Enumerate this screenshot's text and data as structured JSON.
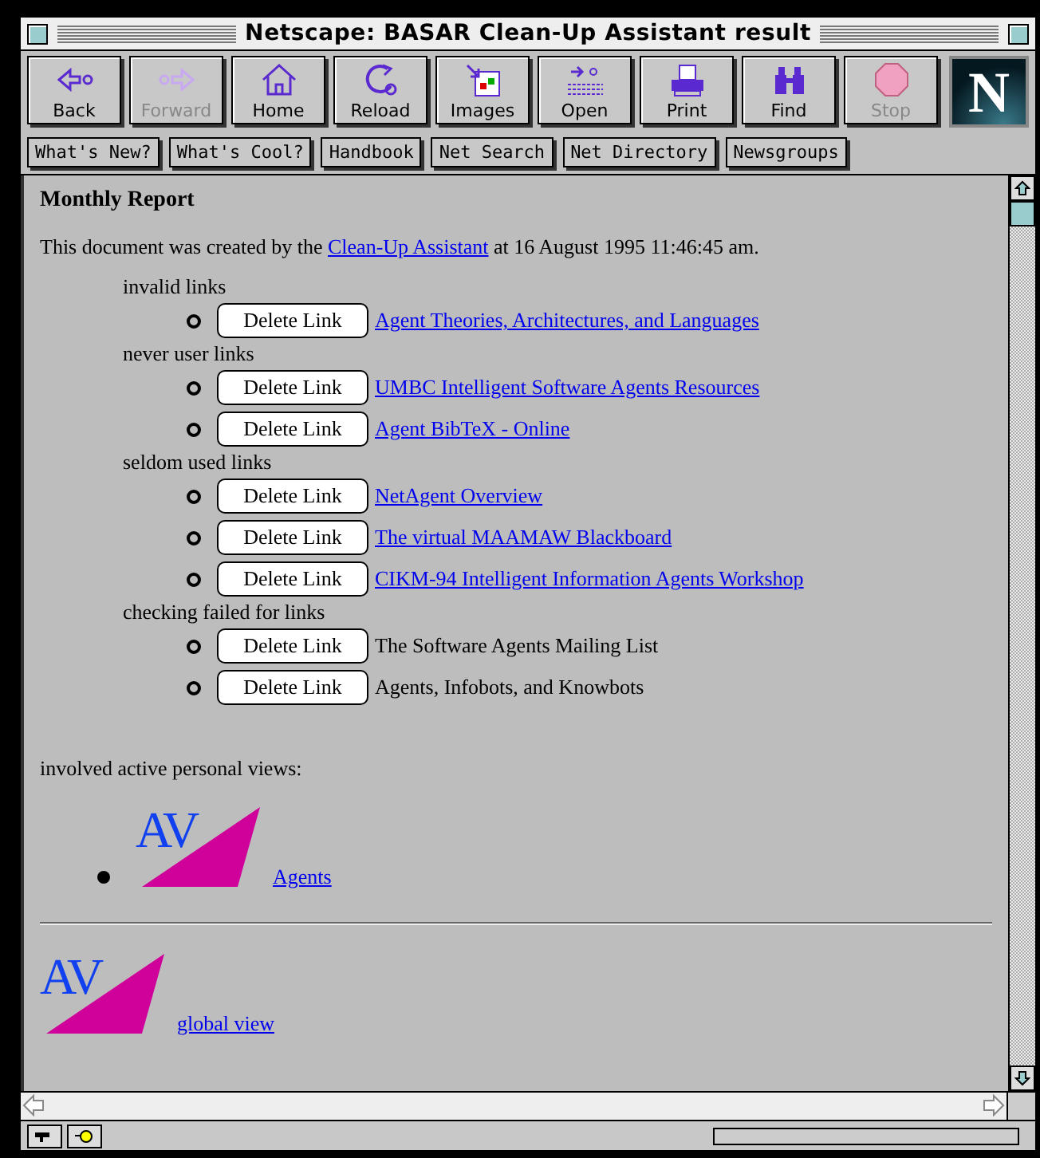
{
  "window": {
    "title": "Netscape: BASAR Clean-Up Assistant result"
  },
  "toolbar": [
    {
      "label": "Back",
      "disabled": false
    },
    {
      "label": "Forward",
      "disabled": true
    },
    {
      "label": "Home",
      "disabled": false
    },
    {
      "label": "Reload",
      "disabled": false
    },
    {
      "label": "Images",
      "disabled": false
    },
    {
      "label": "Open",
      "disabled": false
    },
    {
      "label": "Print",
      "disabled": false
    },
    {
      "label": "Find",
      "disabled": false
    },
    {
      "label": "Stop",
      "disabled": true
    }
  ],
  "progress": {
    "level": 0
  },
  "brand_logo": "N",
  "directory_buttons": [
    "What's New?",
    "What's Cool?",
    "Handbook",
    "Net Search",
    "Net Directory",
    "Newsgroups"
  ],
  "content": {
    "heading": "Monthly Report",
    "intro": {
      "before": "This document was created by the",
      "link": "Clean-Up Assistant",
      "after": "at 16 August 1995 11:46:45 am."
    },
    "groups": [
      {
        "label": "invalid links",
        "items": [
          {
            "button": "Delete Link",
            "title": "Agent Theories, Architectures, and Languages",
            "kind": "link"
          }
        ]
      },
      {
        "label": "never user links",
        "items": [
          {
            "button": "Delete Link",
            "title": "UMBC Intelligent Software Agents Resources",
            "kind": "link"
          },
          {
            "button": "Delete Link",
            "title": "Agent BibTeX - Online",
            "kind": "link"
          }
        ]
      },
      {
        "label": "seldom used links",
        "items": [
          {
            "button": "Delete Link",
            "title": "NetAgent Overview",
            "kind": "link"
          },
          {
            "button": "Delete Link",
            "title": "The virtual MAAMAW Blackboard",
            "kind": "link"
          },
          {
            "button": "Delete Link",
            "title": "CIKM-94 Intelligent Information Agents Workshop",
            "kind": "link"
          }
        ]
      },
      {
        "label": "checking failed for links",
        "items": [
          {
            "button": "Delete Link",
            "title": "The Software Agents Mailing List",
            "kind": "text"
          },
          {
            "button": "Delete Link",
            "title": "Agents, Infobots, and Knowbots",
            "kind": "text"
          }
        ]
      }
    ],
    "views_label": "involved active personal views:",
    "views": [
      {
        "logo": "AV",
        "link": "Agents"
      }
    ],
    "global_view": {
      "logo": "AV",
      "link": "global view"
    }
  }
}
